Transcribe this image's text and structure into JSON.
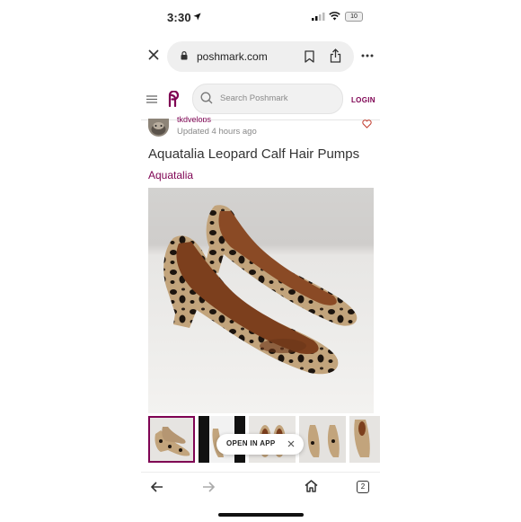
{
  "status_bar": {
    "time": "3:30",
    "battery": "10"
  },
  "browser": {
    "url": "poshmark.com",
    "tab_count": "2"
  },
  "site": {
    "search_placeholder": "Search Poshmark",
    "login_label": "LOGIN",
    "brand_color": "#7f0353"
  },
  "listing": {
    "seller": "tkdvelops",
    "updated": "Updated 4 hours ago",
    "title": "Aquatalia Leopard Calf Hair Pumps",
    "brand": "Aquatalia"
  },
  "open_in_app": {
    "label": "OPEN IN APP"
  },
  "icons": [
    "location-arrow-icon",
    "signal-icon",
    "wifi-icon",
    "battery-icon",
    "close-icon",
    "lock-icon",
    "bookmark-icon",
    "share-icon",
    "more-icon",
    "menu-icon",
    "poshmark-logo",
    "search-icon",
    "heart-icon",
    "back-icon",
    "forward-icon",
    "home-icon",
    "tabs-icon"
  ]
}
